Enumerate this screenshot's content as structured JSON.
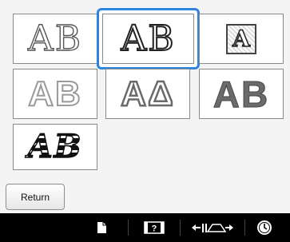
{
  "font_options": [
    {
      "id": "floral-outline",
      "label": "AB",
      "selected": false
    },
    {
      "id": "floral-dark",
      "label": "AB",
      "selected": true
    },
    {
      "id": "framed-a",
      "label": "A",
      "selected": false
    },
    {
      "id": "block-outline",
      "label": "AB",
      "selected": false
    },
    {
      "id": "alpha-delta",
      "label": "AΔ",
      "selected": false
    },
    {
      "id": "block-solid",
      "label": "AB",
      "selected": false
    },
    {
      "id": "striped-script",
      "label": "AB",
      "selected": false
    }
  ],
  "buttons": {
    "return_label": "Return"
  },
  "bottom_bar": {
    "icons": [
      "page-icon",
      "help-icon",
      "width-adjust-icon",
      "clock-icon"
    ]
  },
  "colors": {
    "selection": "#2f84e0",
    "bottom_bar": "#000000"
  }
}
